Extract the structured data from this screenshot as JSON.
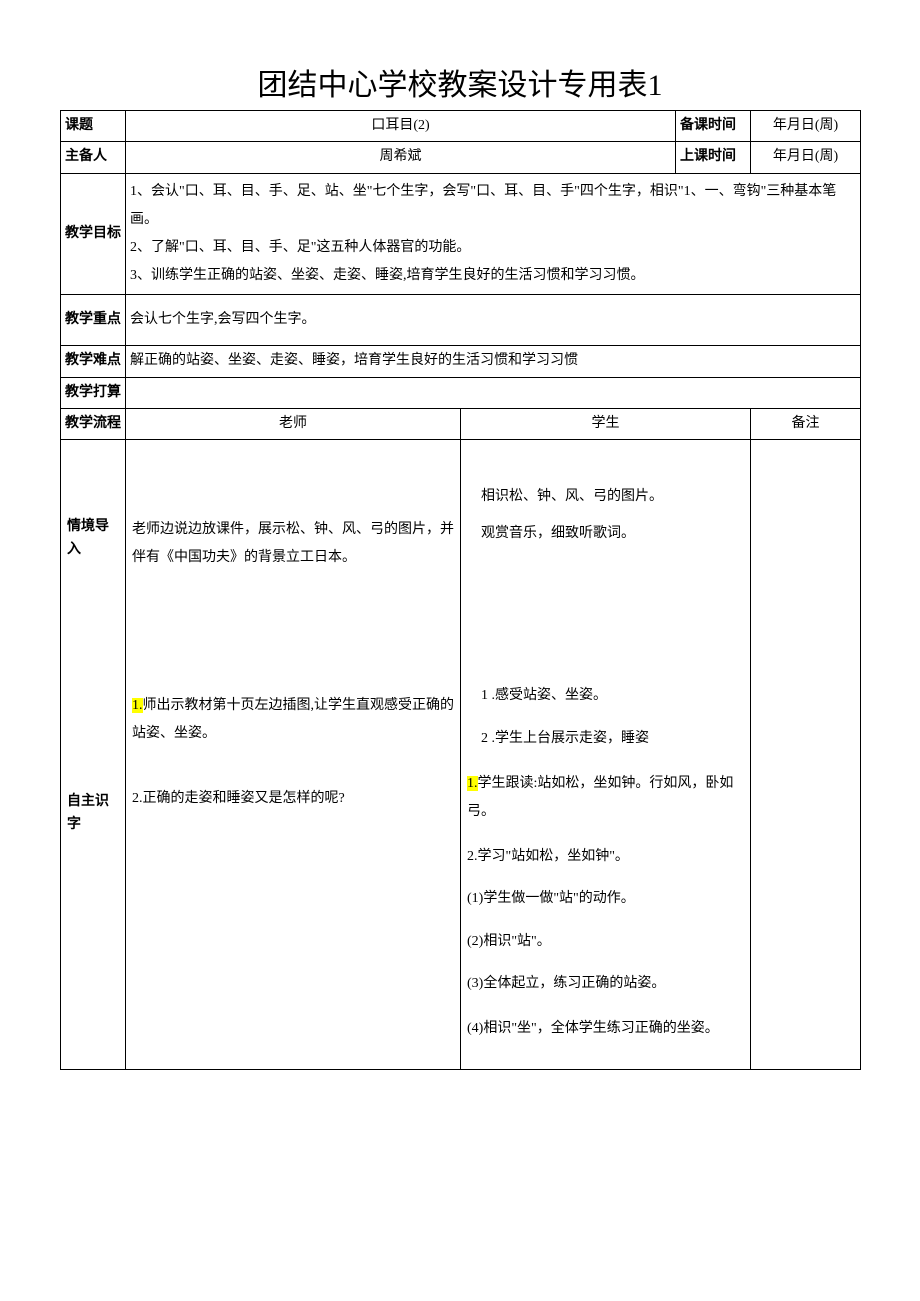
{
  "title": "团结中心学校教案设计专用表1",
  "header": {
    "lesson_topic_label": "课题",
    "lesson_topic_value": "口耳目(2)",
    "prep_time_label": "备课时间",
    "prep_time_value": "年月日(周)",
    "author_label": "主备人",
    "author_value": "周希斌",
    "class_time_label": "上课时间",
    "class_time_value": "年月日(周)"
  },
  "rows": {
    "objectives_label": "教学目标",
    "objectives_text1": "1、会认\"口、耳、目、手、足、站、坐\"七个生字，会写\"口、耳、目、手\"四个生字，相识\"1、一、弯钩\"三种基本笔画。",
    "objectives_text2": "2、了解\"口、耳、目、手、足\"这五种人体器官的功能。",
    "objectives_text3": "3、训练学生正确的站姿、坐姿、走姿、睡姿,培育学生良好的生活习惯和学习习惯。",
    "key_points_label": "教学重点",
    "key_points_value": "会认七个生字,会写四个生字。",
    "difficulties_label": "教学难点",
    "difficulties_value": "解正确的站姿、坐姿、走姿、睡姿，培育学生良好的生活习惯和学习习惯",
    "preparation_label": "教学打算",
    "preparation_value": "",
    "flow_label": "教学流程",
    "teacher_label": "老师",
    "student_label": "学生",
    "notes_label": "备注"
  },
  "flow": {
    "section1": {
      "name": "情境导入",
      "teacher": "老师边说边放课件，展示松、钟、风、弓的图片，并伴有《中国功夫》的背景立工日本。",
      "student_l1": "相识松、钟、风、弓的图片。",
      "student_l2": "观赏音乐，细致听歌词。"
    },
    "section2": {
      "name": "自主识字",
      "teacher_t1_prefix": "1.",
      "teacher_t1": "师出示教材第十页左边插图,让学生直观感受正确的站姿、坐姿。",
      "teacher_t2": "2.正确的走姿和睡姿又是怎样的呢?",
      "student_s1": "1 .感受站姿、坐姿。",
      "student_s2": "2 .学生上台展示走姿，睡姿",
      "student_s3_prefix": "1.",
      "student_s3": "学生跟读:站如松，坐如钟。行如风，卧如弓。",
      "student_s4": "2.学习\"站如松，坐如钟\"。",
      "student_s5": "(1)学生做一做\"站\"的动作。",
      "student_s6": "(2)相识\"站\"。",
      "student_s7": "(3)全体起立，练习正确的站姿。",
      "student_s8": "(4)相识\"坐\"，全体学生练习正确的坐姿。"
    }
  }
}
